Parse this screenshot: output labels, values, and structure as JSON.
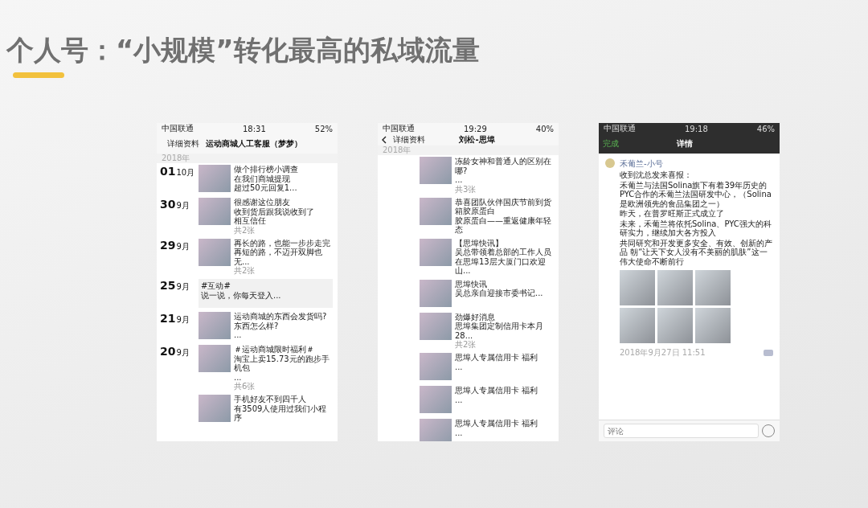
{
  "title": "个人号：“小规模”转化最高的私域流量",
  "phones": [
    {
      "kind": "timeline",
      "status": {
        "carrier": "中国联通",
        "time": "18:31",
        "battery": "52%"
      },
      "nav": {
        "back": "详细资料",
        "title": "运动商城人工客服（梦梦）"
      },
      "year": "2018年",
      "posts": [
        {
          "kind": "photo",
          "day": "01",
          "month": "10月",
          "lines": [
            "做个排行榜小调查",
            "在我们商城提现",
            "超过50元回复1..."
          ]
        },
        {
          "kind": "photo",
          "day": "30",
          "month": "9月",
          "lines": [
            "很感谢这位朋友",
            "收到货后跟我说收到了",
            "相互信任"
          ],
          "count": "共2张"
        },
        {
          "kind": "photo",
          "day": "29",
          "month": "9月",
          "lines": [
            "再长的路，也能一步步走完",
            "再短的路，不迈开双脚也无..."
          ],
          "count": "共2张"
        },
        {
          "kind": "text",
          "day": "25",
          "month": "9月",
          "lines": [
            "#互动#",
            "说一说，你每天登入..."
          ]
        },
        {
          "kind": "photo",
          "day": "21",
          "month": "9月",
          "lines": [
            "运动商城的东西会发货吗?",
            "东西怎么样?",
            "..."
          ]
        },
        {
          "kind": "photo",
          "day": "20",
          "month": "9月",
          "lines": [
            "＃运动商城限时福利＃",
            "淘宝上卖15.73元的跑步手机包",
            "..."
          ],
          "count": "共6张"
        },
        {
          "kind": "photo",
          "lines": [
            "手机好友不到四千人",
            "有3509人使用过我们小程序"
          ]
        }
      ]
    },
    {
      "kind": "timeline",
      "status": {
        "carrier": "中国联通",
        "time": "19:29",
        "battery": "40%"
      },
      "nav": {
        "back": "详细资料",
        "title": "刘松-思埠"
      },
      "year": "2018年",
      "posts": [
        {
          "kind": "photo",
          "lines": [
            "冻龄女神和普通人的区别在哪?",
            "..."
          ],
          "count": "共3张"
        },
        {
          "kind": "photo",
          "lines": [
            "恭喜团队伙伴国庆节前到货",
            "箱胶原蛋白",
            "胶原蛋白——重返健康年轻态"
          ]
        },
        {
          "kind": "photo",
          "lines": [
            "【思埠快讯】",
            "吴总带领着总部的工作人员在思埠13层大厦门口欢迎山..."
          ]
        },
        {
          "kind": "photo",
          "lines": [
            "思埠快讯",
            "吴总亲自迎接市委书记..."
          ]
        },
        {
          "kind": "photo",
          "lines": [
            "劲爆好消息",
            "思埠集团定制信用卡本月28..."
          ],
          "count": "共2张"
        },
        {
          "kind": "photo",
          "lines": [
            "思埠人专属信用卡 福利",
            "..."
          ]
        },
        {
          "kind": "photo",
          "lines": [
            "思埠人专属信用卡 福利",
            "..."
          ]
        },
        {
          "kind": "photo",
          "lines": [
            "思埠人专属信用卡 福利",
            "..."
          ]
        }
      ]
    },
    {
      "kind": "detail",
      "status": {
        "carrier": "中国联通",
        "time": "19:18",
        "battery": "46%"
      },
      "nav": {
        "back": "完成",
        "title": "详情"
      },
      "author": "禾葡兰-小号",
      "lines": [
        "收到沈总发来喜报：",
        "禾葡兰与法国Solina旗下有着39年历史的PYC合作的禾葡兰法国研发中心，（Solina是欧洲领先的食品集团之一）",
        "昨天，在普罗旺斯正式成立了",
        "未来，禾葡兰将依托Solina、PYC强大的科研实力，继续加大各方投入",
        "共同研究和开发更多安全、有效、创新的产品 朝“让天下女人没有不美丽的肌肤”这一伟大使命不断前行"
      ],
      "timestamp": "2018年9月27日 11:51",
      "comment": {
        "placeholder": "评论"
      }
    }
  ]
}
